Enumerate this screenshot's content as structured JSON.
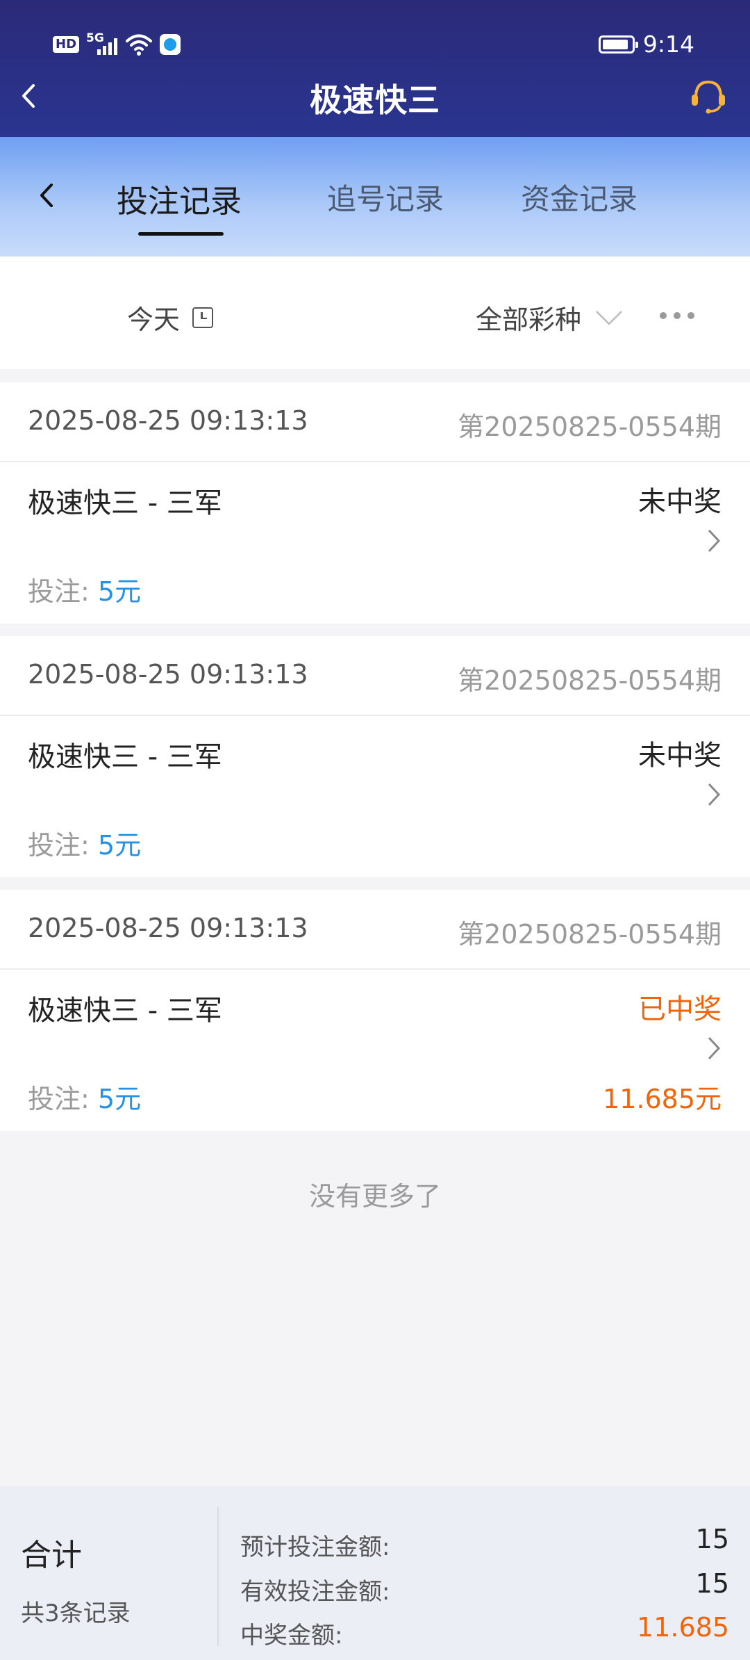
{
  "status_bar": {
    "hd_label": "HD",
    "network_label": "5G",
    "time": "9:14"
  },
  "header": {
    "title": "极速快三",
    "back_icon": "chevron-left-icon",
    "support_icon": "headset-icon"
  },
  "tabs": [
    {
      "label": "投注记录",
      "active": true
    },
    {
      "label": "追号记录",
      "active": false
    },
    {
      "label": "资金记录",
      "active": false
    }
  ],
  "filter": {
    "date_label": "今天",
    "lottery_label": "全部彩种"
  },
  "records": [
    {
      "datetime": "2025-08-25 09:13:13",
      "issue": "第20250825-0554期",
      "name": "极速快三 - 三军",
      "status": "未中奖",
      "won": false,
      "bet_label": "投注: ",
      "bet_amount": "5元",
      "prize": ""
    },
    {
      "datetime": "2025-08-25 09:13:13",
      "issue": "第20250825-0554期",
      "name": "极速快三 - 三军",
      "status": "未中奖",
      "won": false,
      "bet_label": "投注: ",
      "bet_amount": "5元",
      "prize": ""
    },
    {
      "datetime": "2025-08-25 09:13:13",
      "issue": "第20250825-0554期",
      "name": "极速快三 - 三军",
      "status": "已中奖",
      "won": true,
      "bet_label": "投注: ",
      "bet_amount": "5元",
      "prize": "11.685元"
    }
  ],
  "no_more_text": "没有更多了",
  "summary": {
    "title": "合计",
    "count_text": "共3条记录",
    "rows": [
      {
        "label": "预计投注金额:",
        "value": "15",
        "highlight": false
      },
      {
        "label": "有效投注金额:",
        "value": "15",
        "highlight": false
      },
      {
        "label": "中奖金额:",
        "value": "11.685",
        "highlight": true
      }
    ]
  },
  "colors": {
    "header_bg": "#2b2a78",
    "tab_gradient_top": "#6f9ff2",
    "win_orange": "#f0650a",
    "bet_blue": "#2592e6"
  }
}
